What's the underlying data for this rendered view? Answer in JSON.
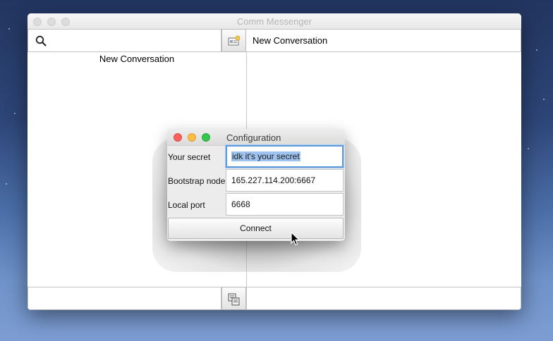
{
  "window": {
    "title": "Comm Messenger"
  },
  "search": {
    "placeholder": ""
  },
  "conversation_header": {
    "title": "New Conversation"
  },
  "conversation_list": [
    {
      "label": "New Conversation"
    }
  ],
  "dialog": {
    "title": "Configuration",
    "fields": [
      {
        "label": "Your secret",
        "value": "idk it's your secret"
      },
      {
        "label": "Bootstrap node",
        "value": "165.227.114.200:6667"
      },
      {
        "label": "Local port",
        "value": "6668"
      }
    ],
    "connect_label": "Connect"
  },
  "icons": {
    "search": "search-icon",
    "new_conversation": "contact-card-icon",
    "attach": "copy-icon",
    "cursor": "cursor-arrow-icon"
  },
  "colors": {
    "close": "#fc605c",
    "minimize": "#fdbc40",
    "zoom": "#34c84a",
    "focus_ring": "#5f9bd8",
    "selection": "#9ec3ee"
  }
}
